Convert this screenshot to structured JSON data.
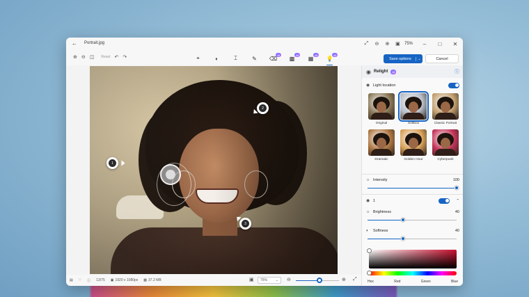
{
  "window": {
    "title": "Portrait.jpg",
    "zoom": "75%",
    "back_icon": "arrow-left-icon"
  },
  "toolbar": {
    "reset_label": "Reset",
    "save_label": "Save options",
    "cancel_label": "Cancel",
    "tools": [
      {
        "name": "crop",
        "icon": "crop-icon",
        "ai": false,
        "active": false
      },
      {
        "name": "adjust",
        "icon": "adjust-icon",
        "ai": false,
        "active": false
      },
      {
        "name": "filter",
        "icon": "filter-icon",
        "ai": false,
        "active": false
      },
      {
        "name": "markup",
        "icon": "pen-icon",
        "ai": false,
        "active": false
      },
      {
        "name": "erase",
        "icon": "eraser-icon",
        "ai": true,
        "active": false
      },
      {
        "name": "background",
        "icon": "background-icon",
        "ai": true,
        "active": false
      },
      {
        "name": "restyle",
        "icon": "restyle-icon",
        "ai": true,
        "active": false
      },
      {
        "name": "relight",
        "icon": "bulb-icon",
        "ai": true,
        "active": true
      }
    ],
    "ai_badge": "AI"
  },
  "canvas": {
    "pins": [
      {
        "label": "1"
      },
      {
        "label": "2"
      },
      {
        "label": "3"
      }
    ]
  },
  "statusbar": {
    "index": "13/75",
    "dimensions": "1920 x 1080px",
    "size": "37.2 MB",
    "zoom_value": "75%",
    "zoom_level": 0.55
  },
  "panel": {
    "title": "Relight",
    "ai_badge": "AI",
    "light_location_label": "Light location",
    "presets": [
      {
        "label": "Original",
        "tone": "#8c7a5a",
        "selected": false
      },
      {
        "label": "Softbox",
        "tone": "#b8bfc8",
        "selected": true
      },
      {
        "label": "Classic Portrait",
        "tone": "#c2a070",
        "selected": false
      },
      {
        "label": "Dramatic",
        "tone": "#b07a45",
        "selected": false
      },
      {
        "label": "Golden Hour",
        "tone": "#d8a25a",
        "selected": false
      },
      {
        "label": "Cyberpunk",
        "tone": "#c4365a",
        "selected": false
      }
    ],
    "intensity_label": "Intensity",
    "intensity_value": "100",
    "intensity_level": 1.0,
    "light_name": "1",
    "brightness_label": "Brightness",
    "brightness_value": "40",
    "brightness_level": 0.4,
    "softness_label": "Softness",
    "softness_value": "40",
    "softness_level": 0.4,
    "color_labels": [
      "Hex",
      "Red",
      "Green",
      "Blue"
    ]
  },
  "colors": {
    "accent": "#1764c4",
    "ai_badge": "#8a6bff"
  }
}
